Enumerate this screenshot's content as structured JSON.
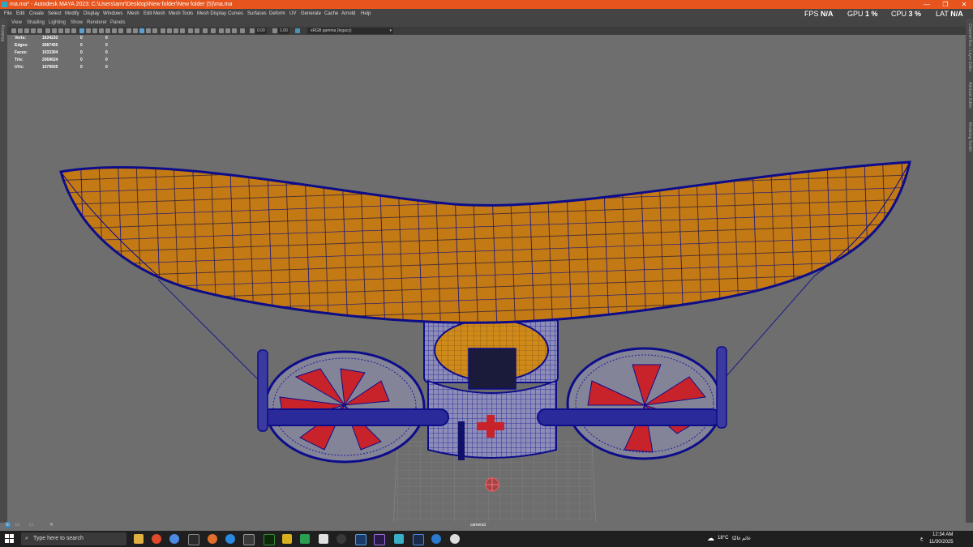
{
  "window": {
    "title": "ma.ma* - Autodesk MAYA 2023: C:\\Users\\amr\\Desktop\\New folder\\New folder (5)\\ma.ma",
    "minimize": "—",
    "maximize": "❐",
    "close": "✕"
  },
  "menu": [
    "File",
    "Edit",
    "Create",
    "Select",
    "Modify",
    "Display",
    "Windows",
    "Mesh",
    "Edit Mesh",
    "Mesh Tools",
    "Mesh Display",
    "Curves",
    "Surfaces",
    "Deform",
    "UV",
    "Generate",
    "Cache",
    "Arnold",
    "Help"
  ],
  "hud": {
    "fps_label": "FPS",
    "fps_value": "N/A",
    "gpu_label": "GPU",
    "gpu_value": "1 %",
    "cpu_label": "CPU",
    "cpu_value": "3 %",
    "lat_label": "LAT",
    "lat_value": "N/A"
  },
  "left_panel_label": "Modeling",
  "right_panel_labels": [
    "Channel Box / Layer Editor",
    "Attribute Editor",
    "Modeling Toolkit"
  ],
  "panel_menu": [
    "View",
    "Shading",
    "Lighting",
    "Show",
    "Renderer",
    "Panels"
  ],
  "toolbar": {
    "exposure": "0.00",
    "gamma": "1.00",
    "color_space": "sRGB gamma (legacy)"
  },
  "stats": [
    {
      "label": "Verts:",
      "total": "1634233",
      "sel": "0",
      "sel2": "0"
    },
    {
      "label": "Edges:",
      "total": "2687455",
      "sel": "0",
      "sel2": "0"
    },
    {
      "label": "Faces:",
      "total": "1033304",
      "sel": "0",
      "sel2": "0"
    },
    {
      "label": "Tris:",
      "total": "2069624",
      "sel": "0",
      "sel2": "0"
    },
    {
      "label": "UVs:",
      "total": "1079505",
      "sel": "0",
      "sel2": "0"
    }
  ],
  "camera_label": "camera1",
  "taskbar": {
    "search_placeholder": "Type here to search",
    "weather": "18°C",
    "weather_text": "غائم غالبًا",
    "lang": "ع",
    "time": "12:34 AM",
    "date": "11/30/2025"
  },
  "colors": {
    "title_bar": "#e8541e",
    "viewport_bg": "#6e6e6e",
    "wing_fill": "#c47a14",
    "wire": "#0d0d8a",
    "propeller": "#c8232a"
  }
}
